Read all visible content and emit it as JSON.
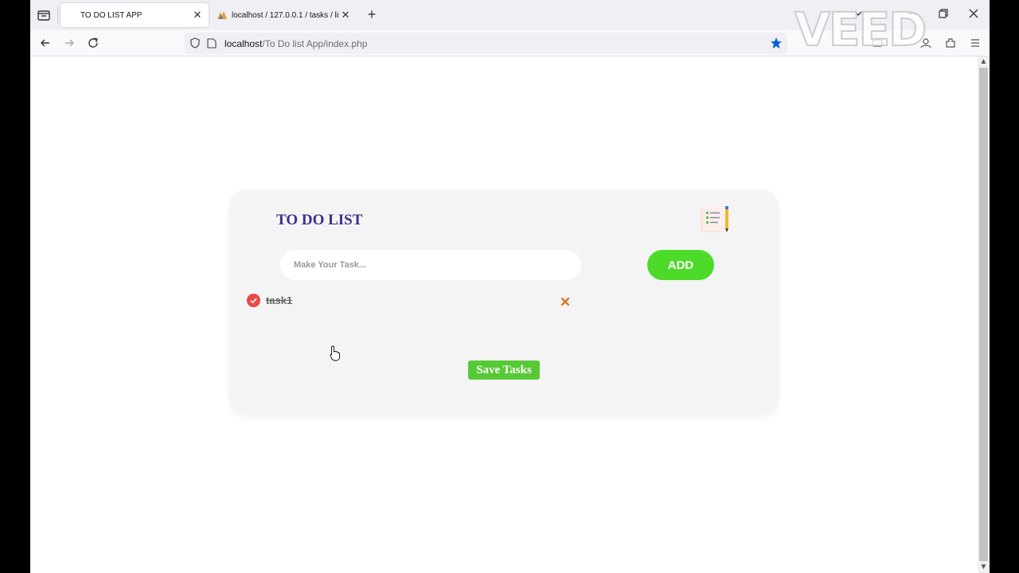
{
  "browser": {
    "tabs": [
      {
        "title": "TO DO LIST APP",
        "active": true
      },
      {
        "title": "localhost / 127.0.0.1 / tasks / list",
        "active": false
      }
    ],
    "url_host": "localhost",
    "url_path": "/To Do list App/index.php",
    "watermark": "VEED"
  },
  "app": {
    "title": "TO DO LIST",
    "input_placeholder": "Make Your Task...",
    "input_value": "",
    "add_label": "ADD",
    "tasks": [
      {
        "text": "task1",
        "completed": true
      }
    ],
    "save_label": "Save Tasks"
  },
  "colors": {
    "accent_green": "#4ddb2a",
    "title_purple": "#3b2f8f",
    "check_red": "#e84a4a",
    "delete_orange": "#e06a1a"
  },
  "icons": [
    "tab-list-icon",
    "close-icon",
    "plus-icon",
    "back-icon",
    "forward-icon",
    "reload-icon",
    "shield-icon",
    "page-icon",
    "star-icon",
    "notepad-icon",
    "check-icon",
    "delete-icon",
    "pointer-cursor-icon"
  ]
}
